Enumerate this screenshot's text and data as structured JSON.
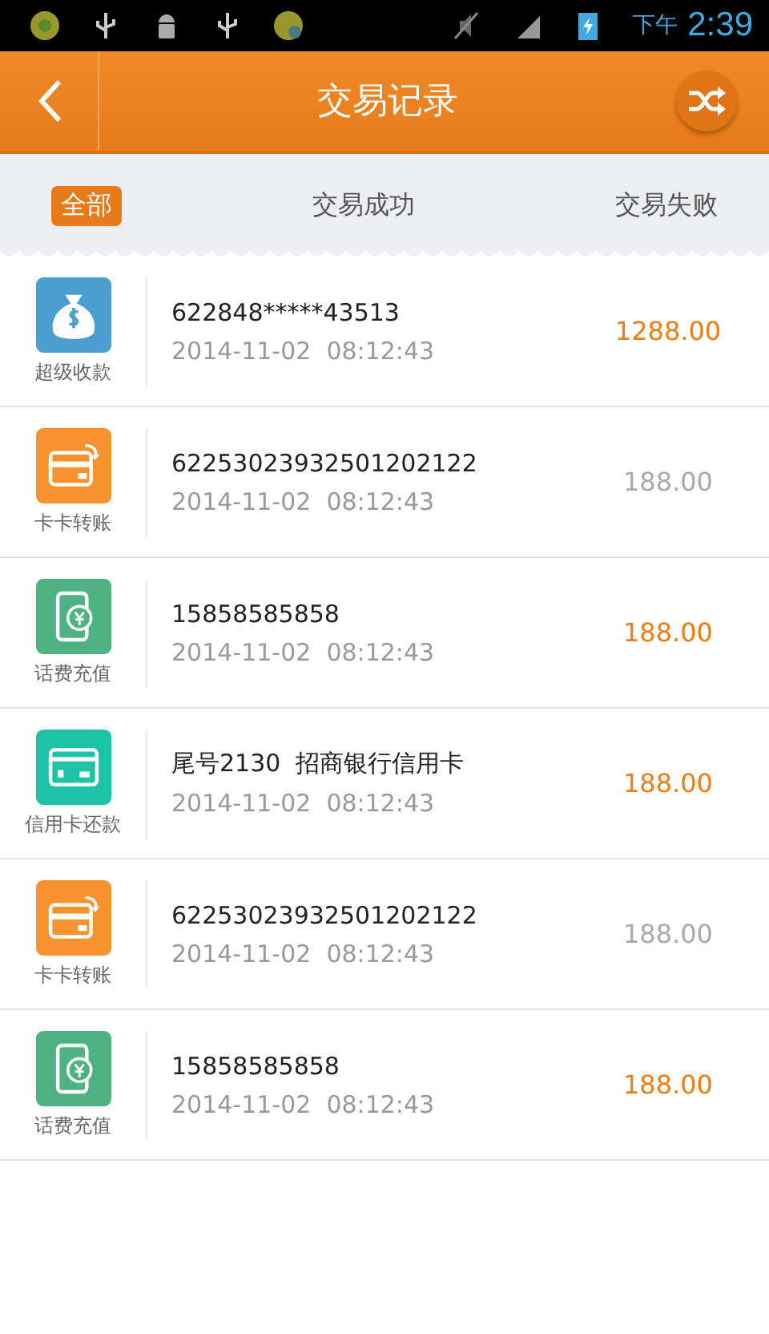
{
  "status_bar": {
    "period": "下午",
    "time": "2:39"
  },
  "header": {
    "title": "交易记录"
  },
  "tabs": [
    {
      "label": "全部",
      "selected": true
    },
    {
      "label": "交易成功",
      "selected": false
    },
    {
      "label": "交易失败",
      "selected": false
    }
  ],
  "records": [
    {
      "kind": "money",
      "type_label": "超级收款",
      "account": "622848*****43513",
      "time": "2014-11-02  08:12:43",
      "amount": "1288.00",
      "failed": false
    },
    {
      "kind": "transfer",
      "type_label": "卡卡转账",
      "account": "62253023932501202122",
      "time": "2014-11-02  08:12:43",
      "amount": "188.00",
      "failed": true
    },
    {
      "kind": "phone",
      "type_label": "话费充值",
      "account": "15858585858",
      "time": "2014-11-02  08:12:43",
      "amount": "188.00",
      "failed": false
    },
    {
      "kind": "card",
      "type_label": "信用卡还款",
      "account": "尾号2130  招商银行信用卡",
      "time": "2014-11-02  08:12:43",
      "amount": "188.00",
      "failed": false
    },
    {
      "kind": "transfer",
      "type_label": "卡卡转账",
      "account": "62253023932501202122",
      "time": "2014-11-02  08:12:43",
      "amount": "188.00",
      "failed": true
    },
    {
      "kind": "phone",
      "type_label": "话费充值",
      "account": "15858585858",
      "time": "2014-11-02  08:12:43",
      "amount": "188.00",
      "failed": false
    }
  ]
}
